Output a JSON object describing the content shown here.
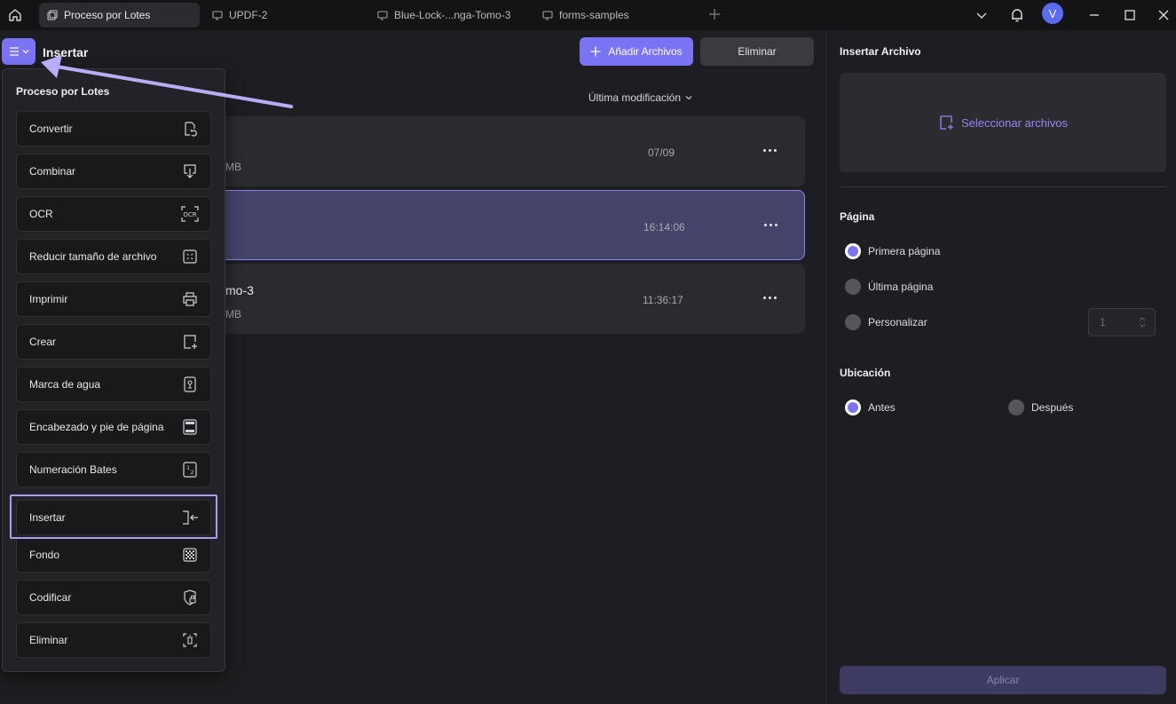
{
  "tabs": [
    {
      "label": "Proceso por Lotes",
      "active": true
    },
    {
      "label": "UPDF-2",
      "active": false
    },
    {
      "label": "Blue-Lock-...nga-Tomo-3",
      "active": false
    },
    {
      "label": "forms-samples",
      "active": false
    }
  ],
  "user": {
    "initial": "V"
  },
  "header": {
    "title": "Insertar",
    "add_files_label": "Añadir Archivos",
    "delete_label": "Eliminar",
    "sort_label": "Última modificación"
  },
  "files": [
    {
      "name": "",
      "size": "MB",
      "time": "07/09"
    },
    {
      "name": "",
      "size": "",
      "time": "16:14:06"
    },
    {
      "name": "mo-3",
      "size": "MB",
      "time": "11:36:17"
    }
  ],
  "dropdown": {
    "title": "Proceso por Lotes",
    "items": [
      {
        "label": "Convertir",
        "icon": "convert-icon"
      },
      {
        "label": "Combinar",
        "icon": "combine-icon"
      },
      {
        "label": "OCR",
        "icon": "ocr-icon"
      },
      {
        "label": "Reducir tamaño de archivo",
        "icon": "compress-icon"
      },
      {
        "label": "Imprimir",
        "icon": "print-icon"
      },
      {
        "label": "Crear",
        "icon": "create-icon"
      },
      {
        "label": "Marca de agua",
        "icon": "watermark-icon"
      },
      {
        "label": "Encabezado y pie de página",
        "icon": "header-footer-icon"
      },
      {
        "label": "Numeración Bates",
        "icon": "bates-icon"
      },
      {
        "label": "Insertar",
        "icon": "insert-icon"
      },
      {
        "label": "Fondo",
        "icon": "background-icon"
      },
      {
        "label": "Codificar",
        "icon": "encrypt-icon"
      },
      {
        "label": "Eliminar",
        "icon": "delete-pages-icon"
      }
    ]
  },
  "panel": {
    "title": "Insertar Archivo",
    "select_files_label": "Seleccionar archivos",
    "page_section": "Página",
    "page_options": [
      "Primera página",
      "Última página",
      "Personalizar"
    ],
    "page_selected": 0,
    "custom_page_value": "1",
    "location_section": "Ubicación",
    "location_options": [
      "Antes",
      "Después"
    ],
    "location_selected": 0,
    "apply_label": "Aplicar"
  },
  "colors": {
    "accent": "#7a74f5",
    "highlight": "#a99ef5"
  }
}
